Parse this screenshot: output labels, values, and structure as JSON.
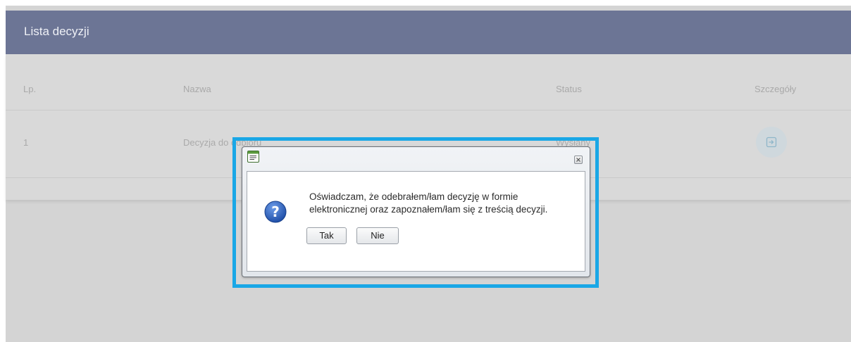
{
  "panel": {
    "title": "Lista decyzji"
  },
  "table": {
    "columns": [
      "Lp.",
      "Nazwa",
      "Status",
      "Szczegóły"
    ],
    "rows": [
      {
        "lp": "1",
        "nazwa": "Decyzja do odbioru",
        "status": "Wysłany",
        "details_icon": "open-details-icon"
      }
    ]
  },
  "dialog": {
    "title_icon": "window-icon",
    "close_icon": "close-icon",
    "message_icon": "question-icon",
    "message_line1": "Oświadczam, że odebrałem/łam decyzję w formie",
    "message_line2": "elektronicznej oraz zapoznałem/łam się z treścią decyzji.",
    "yes_label": "Tak",
    "no_label": "Nie"
  },
  "colors": {
    "header_bg": "#6c7595",
    "overlay_bg": "#d4d4d4",
    "highlight": "#1aa7e6"
  }
}
